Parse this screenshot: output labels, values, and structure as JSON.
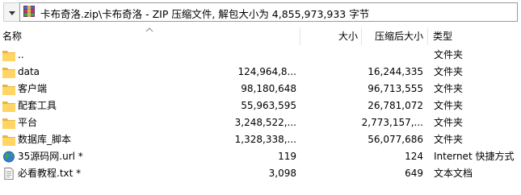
{
  "path_bar": {
    "path": "卡布奇洛.zip\\卡布奇洛 - ZIP 压缩文件, 解包大小为 4,855,973,933 字节"
  },
  "columns": {
    "name": "名称",
    "size": "大小",
    "packed": "压缩后大小",
    "type": "类型"
  },
  "files": [
    {
      "name": "..",
      "size": "",
      "packed": "",
      "type": "文件夹",
      "icon": "folder-icon"
    },
    {
      "name": "data",
      "size": "124,964,8...",
      "packed": "16,244,335",
      "type": "文件夹",
      "icon": "folder-icon"
    },
    {
      "name": "客户端",
      "size": "98,180,648",
      "packed": "96,713,555",
      "type": "文件夹",
      "icon": "folder-icon"
    },
    {
      "name": "配套工具",
      "size": "55,963,595",
      "packed": "26,781,072",
      "type": "文件夹",
      "icon": "folder-icon"
    },
    {
      "name": "平台",
      "size": "3,248,522,...",
      "packed": "2,773,157,...",
      "type": "文件夹",
      "icon": "folder-icon"
    },
    {
      "name": "数据库_脚本",
      "size": "1,328,338,...",
      "packed": "56,077,686",
      "type": "文件夹",
      "icon": "folder-icon"
    },
    {
      "name": "35源码网.url *",
      "size": "119",
      "packed": "124",
      "type": "Internet 快捷方式",
      "icon": "globe-icon"
    },
    {
      "name": "必看教程.txt *",
      "size": "3,098",
      "packed": "649",
      "type": "文本文档",
      "icon": "text-file-icon"
    }
  ],
  "colors": {
    "folder": "#ffd564",
    "header_separator": "#e5e5e5",
    "path_border": "#9a9a9a"
  }
}
